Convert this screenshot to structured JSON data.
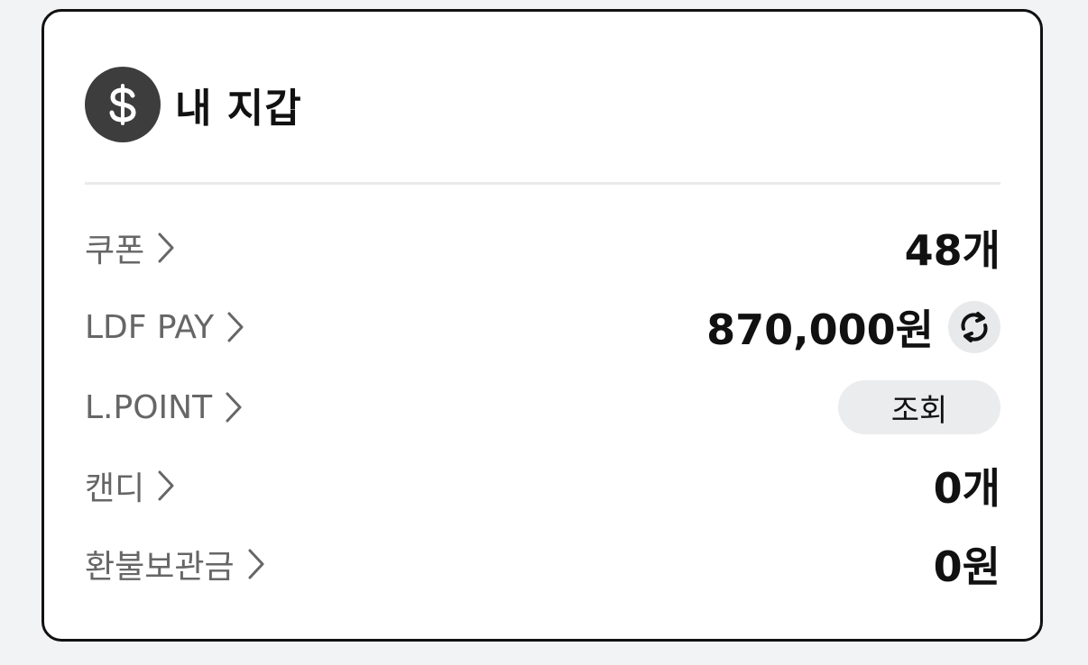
{
  "wallet": {
    "title": "내 지갑",
    "coin_icon": "dollar-coin-icon",
    "rows": [
      {
        "label": "쿠폰",
        "value": "48개",
        "icon": "chevron-right-icon"
      },
      {
        "label": "LDF PAY",
        "value": "870,000원",
        "icon": "chevron-right-icon",
        "action_icon": "refresh-icon"
      },
      {
        "label": "L.POINT",
        "button_label": "조회",
        "icon": "chevron-right-icon"
      },
      {
        "label": "캔디",
        "value": "0개",
        "icon": "chevron-right-icon"
      },
      {
        "label": "환불보관금",
        "value": "0원",
        "icon": "chevron-right-icon"
      }
    ]
  },
  "colors": {
    "border": "#111111",
    "label": "#666666",
    "value": "#111111",
    "coin_bg": "#3d3d3d",
    "button_bg": "#ebecee"
  }
}
